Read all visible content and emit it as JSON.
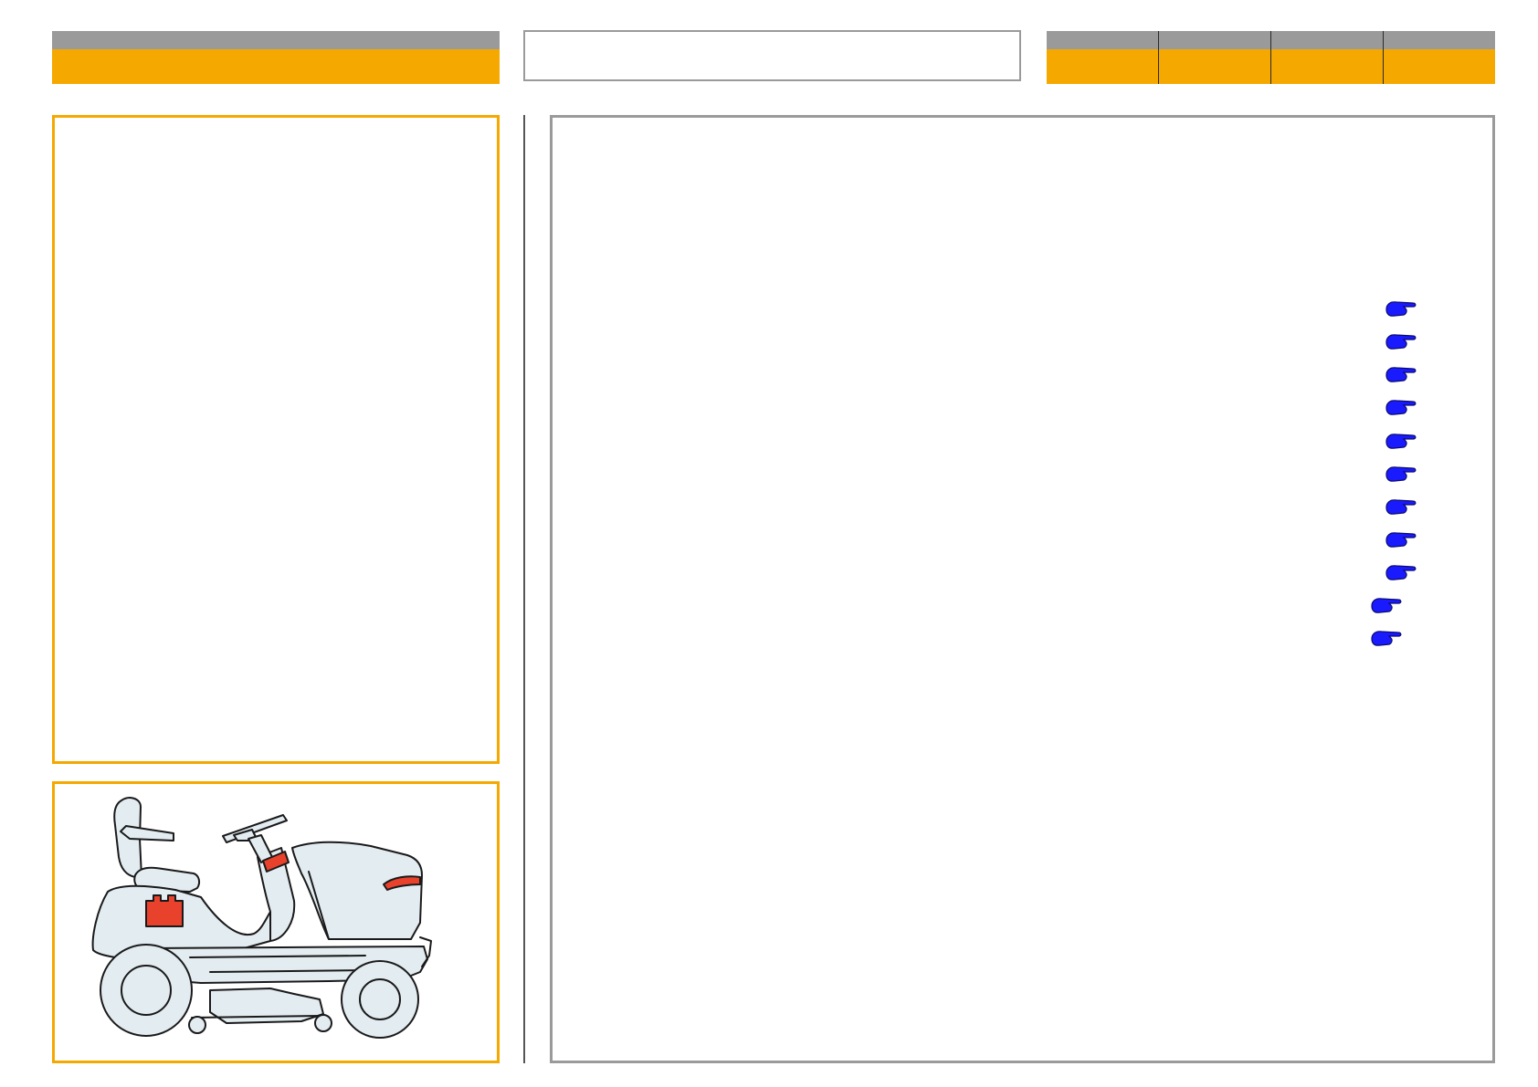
{
  "header": {
    "title": "",
    "tabs": [
      "",
      "",
      "",
      ""
    ]
  },
  "links": {
    "icon": "pointing-hand-icon",
    "color": "#1a1aff",
    "count": 11
  },
  "illustration": {
    "subject": "ride-on-lawn-tractor",
    "highlight_color": "#e8412c",
    "body_color": "#e3ecf1"
  },
  "colors": {
    "accent": "#f5a800",
    "header_grey": "#9a9a9a"
  }
}
